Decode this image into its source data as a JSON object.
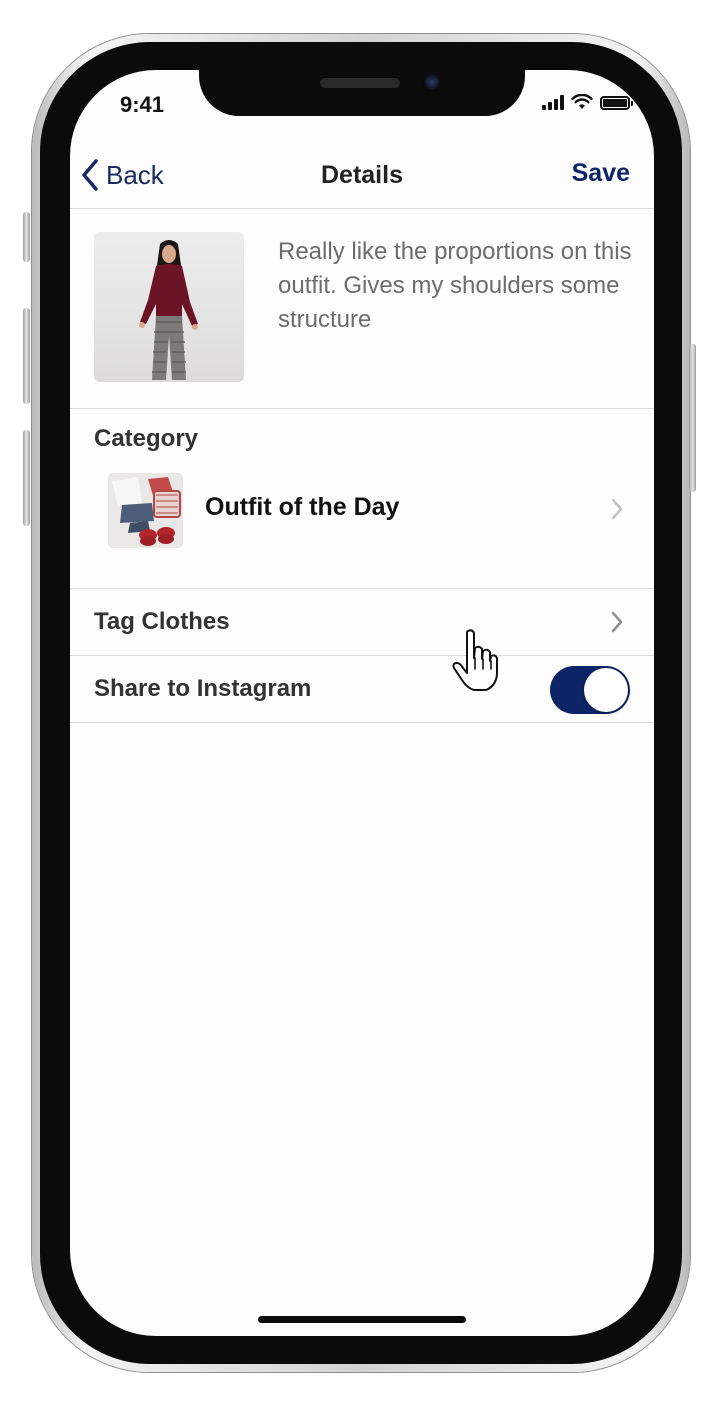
{
  "status_bar": {
    "time": "9:41"
  },
  "nav": {
    "back_label": "Back",
    "title": "Details",
    "save_label": "Save"
  },
  "post": {
    "caption": "Really like the proportions on this outfit. Gives my shoulders some structure"
  },
  "category": {
    "label": "Category",
    "value": "Outfit of the Day"
  },
  "rows": {
    "tag_clothes": "Tag Clothes",
    "share_instagram": "Share to Instagram"
  },
  "toggle": {
    "share_instagram_on": true
  },
  "colors": {
    "accent": "#0d2466",
    "back_link": "#1b2a63",
    "caption_text": "#6c6c6c",
    "divider": "#dcdcdc"
  },
  "icons": [
    "chevron-left-icon",
    "signal-icon",
    "wifi-icon",
    "battery-icon",
    "chevron-right-icon",
    "hand-pointer-icon"
  ]
}
